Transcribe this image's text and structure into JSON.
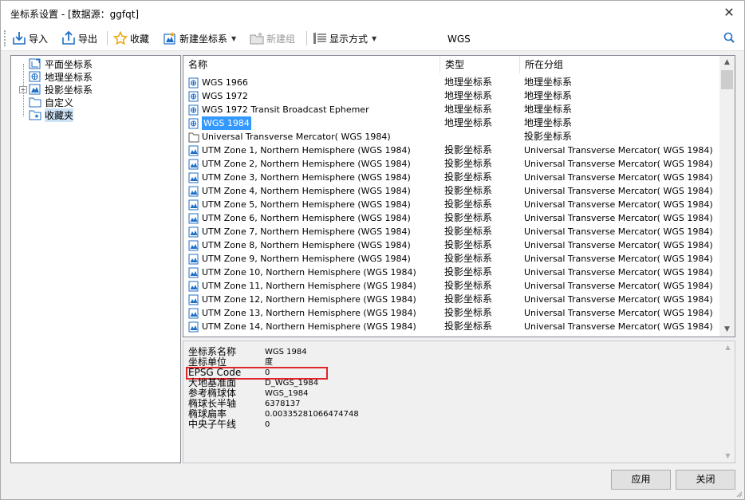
{
  "window": {
    "title": "坐标系设置 - [数据源：ggfqt]",
    "close_symbol": "✕"
  },
  "toolbar": {
    "import_label": "导入",
    "export_label": "导出",
    "favorite_label": "收藏",
    "new_cs_label": "新建坐标系",
    "new_group_label": "新建组",
    "display_mode_label": "显示方式",
    "search_value": "WGS",
    "colors": {
      "icon_blue": "#1f6fc5",
      "star": "#f0a30a",
      "disabled": "#9a9a9a"
    }
  },
  "tree": {
    "items": [
      {
        "label": "平面坐标系",
        "icon": "plane-cs-icon"
      },
      {
        "label": "地理坐标系",
        "icon": "geographic-cs-icon"
      },
      {
        "label": "投影坐标系",
        "icon": "projected-cs-icon",
        "expander": "+"
      },
      {
        "label": "自定义",
        "icon": "folder-icon"
      },
      {
        "label": "收藏夹",
        "icon": "favorites-folder-icon",
        "selected": true
      }
    ]
  },
  "list": {
    "columns": {
      "name": "名称",
      "type": "类型",
      "group": "所在分组"
    },
    "rows": [
      {
        "name": "WGS 1966",
        "type": "地理坐标系",
        "group": "地理坐标系",
        "icon": "geographic-cs-icon"
      },
      {
        "name": "WGS 1972",
        "type": "地理坐标系",
        "group": "地理坐标系",
        "icon": "geographic-cs-icon"
      },
      {
        "name": "WGS 1972 Transit Broadcast Ephemer",
        "type": "地理坐标系",
        "group": "地理坐标系",
        "icon": "geographic-cs-icon"
      },
      {
        "name": "WGS 1984",
        "type": "地理坐标系",
        "group": "地理坐标系",
        "icon": "geographic-cs-icon",
        "selected": true
      },
      {
        "name": "Universal Transverse Mercator( WGS 1984)",
        "type": "",
        "group": "投影坐标系",
        "icon": "folder-icon"
      },
      {
        "name": "UTM Zone 1, Northern Hemisphere (WGS 1984)",
        "type": "投影坐标系",
        "group": "Universal Transverse Mercator( WGS 1984)",
        "icon": "projected-cs-icon"
      },
      {
        "name": "UTM Zone 2, Northern Hemisphere (WGS 1984)",
        "type": "投影坐标系",
        "group": "Universal Transverse Mercator( WGS 1984)",
        "icon": "projected-cs-icon"
      },
      {
        "name": "UTM Zone 3, Northern Hemisphere (WGS 1984)",
        "type": "投影坐标系",
        "group": "Universal Transverse Mercator( WGS 1984)",
        "icon": "projected-cs-icon"
      },
      {
        "name": "UTM Zone 4, Northern Hemisphere (WGS 1984)",
        "type": "投影坐标系",
        "group": "Universal Transverse Mercator( WGS 1984)",
        "icon": "projected-cs-icon"
      },
      {
        "name": "UTM Zone 5, Northern Hemisphere (WGS 1984)",
        "type": "投影坐标系",
        "group": "Universal Transverse Mercator( WGS 1984)",
        "icon": "projected-cs-icon"
      },
      {
        "name": "UTM Zone 6, Northern Hemisphere (WGS 1984)",
        "type": "投影坐标系",
        "group": "Universal Transverse Mercator( WGS 1984)",
        "icon": "projected-cs-icon"
      },
      {
        "name": "UTM Zone 7, Northern Hemisphere (WGS 1984)",
        "type": "投影坐标系",
        "group": "Universal Transverse Mercator( WGS 1984)",
        "icon": "projected-cs-icon"
      },
      {
        "name": "UTM Zone 8, Northern Hemisphere (WGS 1984)",
        "type": "投影坐标系",
        "group": "Universal Transverse Mercator( WGS 1984)",
        "icon": "projected-cs-icon"
      },
      {
        "name": "UTM Zone 9, Northern Hemisphere (WGS 1984)",
        "type": "投影坐标系",
        "group": "Universal Transverse Mercator( WGS 1984)",
        "icon": "projected-cs-icon"
      },
      {
        "name": "UTM Zone 10, Northern Hemisphere (WGS 1984)",
        "type": "投影坐标系",
        "group": "Universal Transverse Mercator( WGS 1984)",
        "icon": "projected-cs-icon"
      },
      {
        "name": "UTM Zone 11, Northern Hemisphere (WGS 1984)",
        "type": "投影坐标系",
        "group": "Universal Transverse Mercator( WGS 1984)",
        "icon": "projected-cs-icon"
      },
      {
        "name": "UTM Zone 12, Northern Hemisphere (WGS 1984)",
        "type": "投影坐标系",
        "group": "Universal Transverse Mercator( WGS 1984)",
        "icon": "projected-cs-icon"
      },
      {
        "name": "UTM Zone 13, Northern Hemisphere (WGS 1984)",
        "type": "投影坐标系",
        "group": "Universal Transverse Mercator( WGS 1984)",
        "icon": "projected-cs-icon"
      },
      {
        "name": "UTM Zone 14, Northern Hemisphere (WGS 1984)",
        "type": "投影坐标系",
        "group": "Universal Transverse Mercator( WGS 1984)",
        "icon": "projected-cs-icon"
      }
    ],
    "selection_color": "#3399ff"
  },
  "properties": {
    "rows": [
      {
        "label": "坐标系名称",
        "value": "WGS 1984"
      },
      {
        "label": "坐标单位",
        "value": "度"
      },
      {
        "label": "EPSG Code",
        "value": "0",
        "highlighted": true
      },
      {
        "label": "大地基准面",
        "value": "D_WGS_1984"
      },
      {
        "label": "参考椭球体",
        "value": "WGS_1984"
      },
      {
        "label": "椭球长半轴",
        "value": "6378137"
      },
      {
        "label": "椭球扁率",
        "value": "0.00335281066474748"
      },
      {
        "label": "中央子午线",
        "value": "0"
      }
    ],
    "highlight_color": "#e0262a"
  },
  "buttons": {
    "apply_label": "应用",
    "close_label": "关闭"
  }
}
